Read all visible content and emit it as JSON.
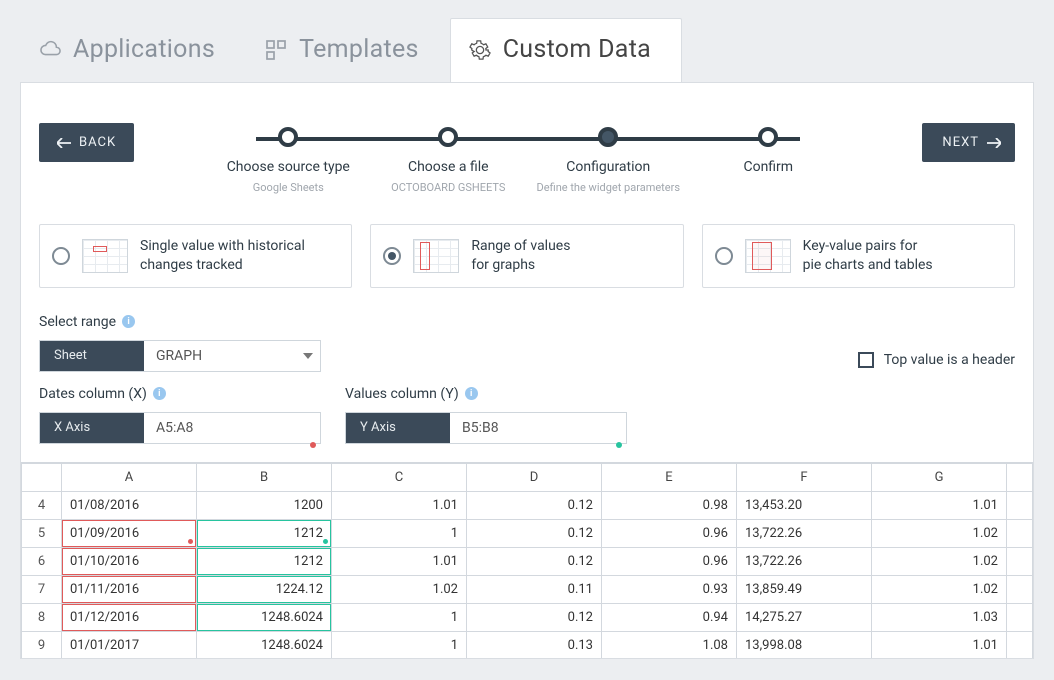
{
  "tabs": [
    {
      "label": "Applications",
      "icon": "cloud-icon"
    },
    {
      "label": "Templates",
      "icon": "grid-icon"
    },
    {
      "label": "Custom Data",
      "icon": "gear-icon"
    }
  ],
  "activeTab": 2,
  "back_label": "BACK",
  "next_label": "NEXT",
  "steps": [
    {
      "title": "Choose source type",
      "sub": "Google Sheets"
    },
    {
      "title": "Choose a file",
      "sub": "OCTOBOARD GSHEETS"
    },
    {
      "title": "Configuration",
      "sub": "Define the widget parameters"
    },
    {
      "title": "Confirm",
      "sub": ""
    }
  ],
  "activeStep": 2,
  "choices": {
    "single": {
      "line1": "Single value with historical",
      "line2": "changes tracked"
    },
    "range": {
      "line1": "Range of values",
      "line2": "for graphs"
    },
    "kv": {
      "line1": "Key-value pairs for",
      "line2": "pie charts and tables"
    }
  },
  "selectedChoice": "range",
  "labels": {
    "select_range": "Select range",
    "sheet": "Sheet",
    "sheet_value": "GRAPH",
    "top_header": "Top value is a header",
    "dates_col": "Dates column (X)",
    "values_col": "Values column (Y)",
    "x_axis": "X Axis",
    "y_axis": "Y Axis",
    "x_value": "A5:A8",
    "y_value": "B5:B8"
  },
  "sheet": {
    "columns": [
      "A",
      "B",
      "C",
      "D",
      "E",
      "F",
      "G"
    ],
    "rows": [
      {
        "n": 4,
        "a": "01/08/2016",
        "b": "1200",
        "c": "1.01",
        "d": "0.12",
        "e": "0.98",
        "f": "13,453.20",
        "g": "1.01"
      },
      {
        "n": 5,
        "a": "01/09/2016",
        "b": "1212",
        "c": "1",
        "d": "0.12",
        "e": "0.96",
        "f": "13,722.26",
        "g": "1.02"
      },
      {
        "n": 6,
        "a": "01/10/2016",
        "b": "1212",
        "c": "1.01",
        "d": "0.12",
        "e": "0.96",
        "f": "13,722.26",
        "g": "1.02"
      },
      {
        "n": 7,
        "a": "01/11/2016",
        "b": "1224.12",
        "c": "1.02",
        "d": "0.11",
        "e": "0.93",
        "f": "13,859.49",
        "g": "1.02"
      },
      {
        "n": 8,
        "a": "01/12/2016",
        "b": "1248.6024",
        "c": "1",
        "d": "0.12",
        "e": "0.94",
        "f": "14,275.27",
        "g": "1.03"
      },
      {
        "n": 9,
        "a": "01/01/2017",
        "b": "1248.6024",
        "c": "1",
        "d": "0.13",
        "e": "1.08",
        "f": "13,998.08",
        "g": "1.01"
      }
    ],
    "x_selection_rows": [
      5,
      6,
      7,
      8
    ],
    "y_selection_rows": [
      5,
      6,
      7,
      8
    ]
  }
}
